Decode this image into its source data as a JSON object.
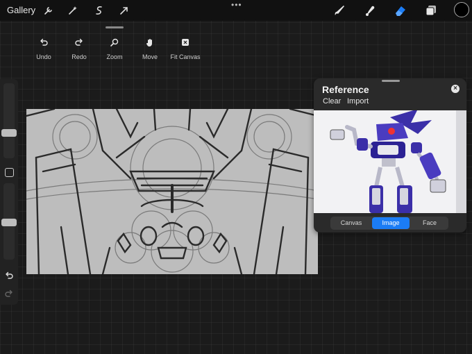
{
  "topbar": {
    "gallery_label": "Gallery",
    "tool_icons": [
      "wrench-icon",
      "magic-wand-icon",
      "selection-icon",
      "transform-arrow-icon"
    ],
    "more_label": "•••",
    "right_tools": [
      "brush-icon",
      "smudge-icon",
      "eraser-icon",
      "layers-icon"
    ],
    "active_tool": "eraser-icon",
    "current_color": "#000000"
  },
  "quick_actions": {
    "undo": "Undo",
    "redo": "Redo",
    "zoom": "Zoom",
    "move": "Move",
    "fit_canvas": "Fit Canvas"
  },
  "sidebar": {
    "brush_size_level": 0.3,
    "opacity_level": 0.4
  },
  "reference": {
    "title": "Reference",
    "clear": "Clear",
    "import": "Import",
    "tabs": [
      "Canvas",
      "Image",
      "Face"
    ],
    "active_tab": "Image",
    "close_glyph": "×"
  },
  "colors": {
    "accent": "#1b7cf5",
    "robot_blue": "#3b2fa8",
    "robot_silver": "#b8b8c8"
  }
}
